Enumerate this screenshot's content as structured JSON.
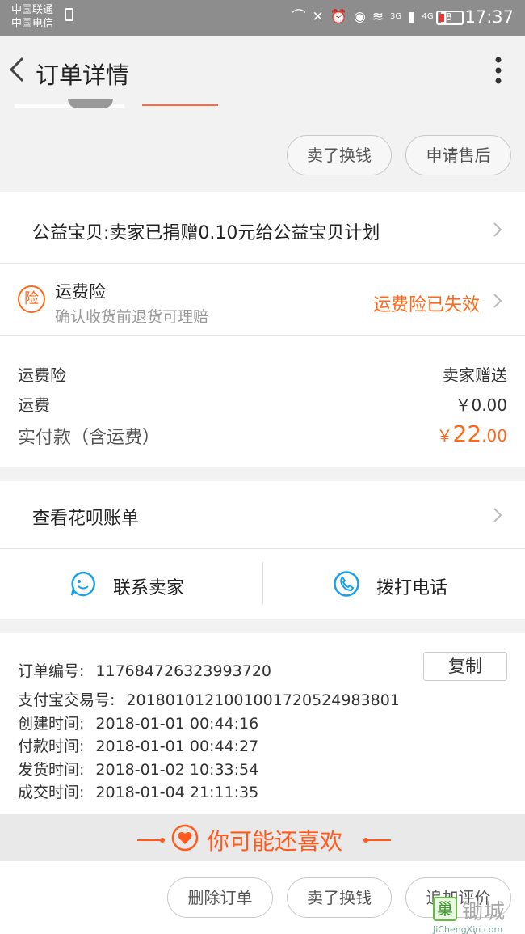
{
  "status_bar": {
    "carrier_1": "中国联通",
    "carrier_2": "中国电信",
    "network_1": "3G",
    "network_2": "4G",
    "battery": "8",
    "time": "17:37"
  },
  "header": {
    "title": "订单详情"
  },
  "top_actions": {
    "sell_label": "卖了换钱",
    "after_sale_label": "申请售后"
  },
  "charity": {
    "text": "公益宝贝:卖家已捐赠0.10元给公益宝贝计划"
  },
  "insurance": {
    "icon_char": "险",
    "title": "运费险",
    "subtitle": "确认收货前退货可理赔",
    "status": "运费险已失效",
    "status_color": "#ff6a1a"
  },
  "prices": {
    "insurance_label": "运费险",
    "insurance_value": "卖家赠送",
    "shipping_label": "运费",
    "shipping_value": "￥0.00",
    "total_label": "实付款（含运费）",
    "total_currency": "￥",
    "total_int": "22",
    "total_dec": ".00"
  },
  "huabei": {
    "label": "查看花呗账单"
  },
  "contact": {
    "seller_label": "联系卖家",
    "phone_label": "拨打电话"
  },
  "order_info": {
    "copy_label": "复制",
    "lines": [
      {
        "label": "订单编号:",
        "value": "117684726323993720"
      },
      {
        "label": "支付宝交易号:",
        "value": "2018010121001001720524983801"
      },
      {
        "label": "创建时间:",
        "value": "2018-01-01 00:44:16"
      },
      {
        "label": "付款时间:",
        "value": "2018-01-01 00:44:27"
      },
      {
        "label": "发货时间:",
        "value": "2018-01-02 10:33:54"
      },
      {
        "label": "成交时间:",
        "value": "2018-01-04 21:11:35"
      }
    ]
  },
  "recommend": {
    "label": "你可能还喜欢"
  },
  "bottom_actions": {
    "delete_label": "删除订单",
    "sell_label": "卖了换钱",
    "review_label": "追加评价"
  },
  "watermark": {
    "box_char": "巢",
    "text": "锄城信",
    "url": "JiChengXin.com"
  },
  "colors": {
    "accent": "#ff6a1a",
    "contact_blue": "#1aa0e8"
  }
}
